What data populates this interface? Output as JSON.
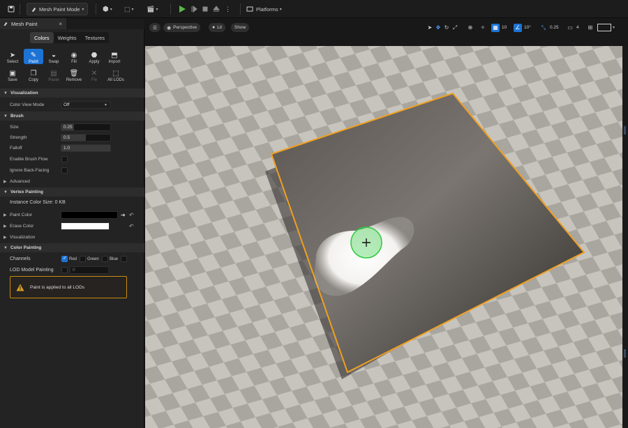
{
  "toolbar": {
    "mode_label": "Mesh Paint Mode",
    "platforms_label": "Platforms"
  },
  "panel": {
    "tab_title": "Mesh Paint",
    "mode_tabs": [
      "Colors",
      "Weights",
      "Textures"
    ],
    "active_mode_tab": "Colors",
    "tools_row1": [
      "Select",
      "Paint",
      "Swap",
      "Fill",
      "Apply",
      "Import"
    ],
    "tools_row2": [
      "Save",
      "Copy",
      "Paste",
      "Remove",
      "Fix",
      "All LODs"
    ],
    "active_tool": "Paint",
    "disabled_tools": [
      "Paste",
      "Fix"
    ],
    "sections": {
      "visualization": "Visualization",
      "brush": "Brush",
      "vertex_painting": "Vertex Painting",
      "color_painting": "Color Painting"
    },
    "color_view_mode": {
      "label": "Color View Mode",
      "value": "Off"
    },
    "brush": {
      "size": {
        "label": "Size",
        "value": "0.25",
        "fraction": 0.25
      },
      "strength": {
        "label": "Strength",
        "value": "0.5",
        "fraction": 0.5
      },
      "falloff": {
        "label": "Falloff",
        "value": "1.0",
        "fraction": 1.0
      },
      "enable_brush_flow": {
        "label": "Enable Brush Flow",
        "checked": false
      },
      "ignore_back_facing": {
        "label": "Ignore Back-Facing",
        "checked": false
      },
      "advanced": "Advanced"
    },
    "vertex_painting": {
      "instance_color_size": "Instance Color Size: 0 KB",
      "paint_color": {
        "label": "Paint Color",
        "value": "#000000"
      },
      "erase_color": {
        "label": "Erase Color",
        "value": "#ffffff"
      },
      "visualization": "Visualization"
    },
    "color_painting": {
      "channels_label": "Channels",
      "channels": [
        {
          "name": "Red",
          "checked": true
        },
        {
          "name": "Green",
          "checked": false
        },
        {
          "name": "Blue",
          "checked": false
        },
        {
          "name": "Alpha",
          "checked": false
        }
      ],
      "lod_model_painting": {
        "label": "LOD Model Painting",
        "checked": false,
        "value": "0"
      }
    },
    "warning": "Paint is applied to all LODs"
  },
  "viewport": {
    "perspective_label": "Perspective",
    "lit_label": "Lit",
    "show_label": "Show",
    "grid_snap": "10",
    "rotation_snap": "10°",
    "scale_snap": "0.25",
    "camera_speed": "4"
  },
  "colors": {
    "accent": "#1d73d4",
    "selection_outline": "#f0a020",
    "brush_cursor": "#2ecc40",
    "warning": "#e0a020"
  }
}
